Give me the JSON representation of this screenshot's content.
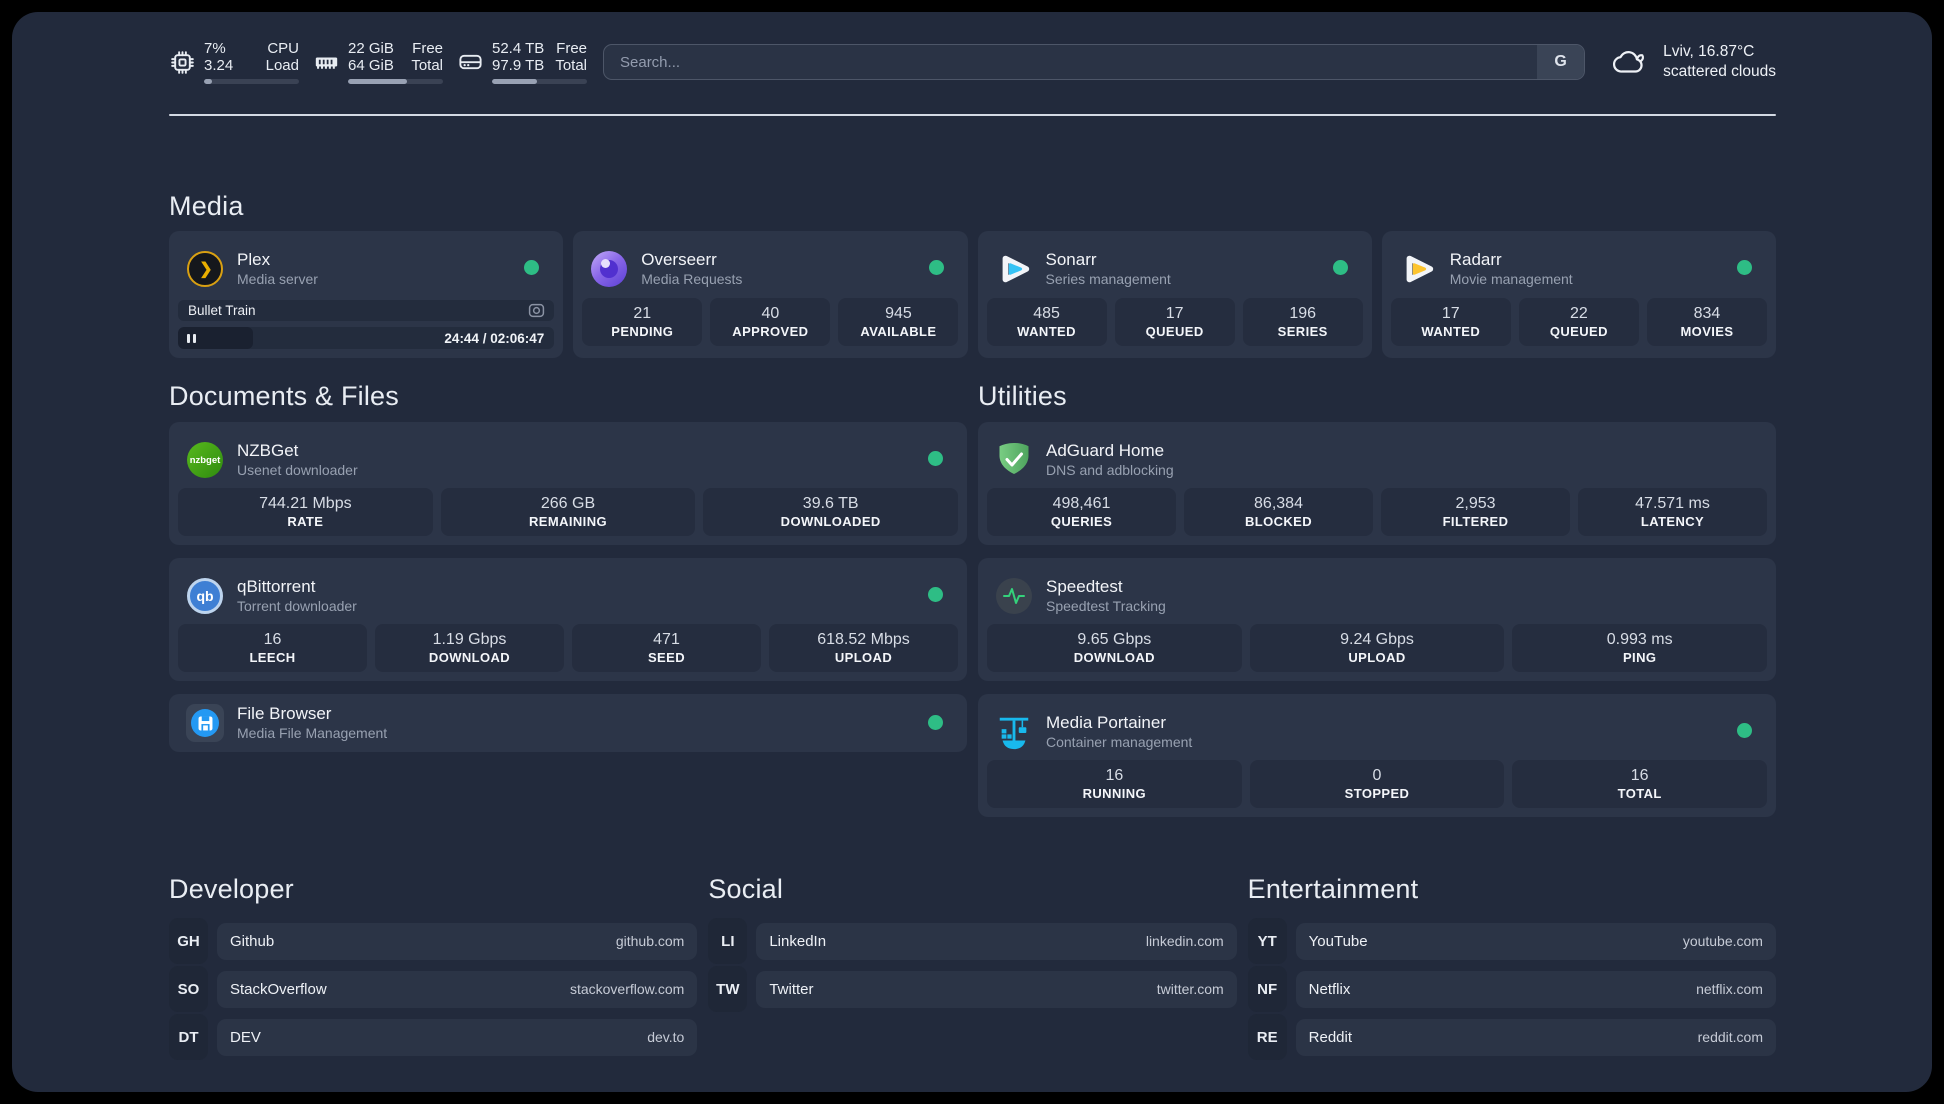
{
  "topbar": {
    "system": [
      {
        "icon": "cpu-icon",
        "col1": [
          "7%",
          "3.24"
        ],
        "col2": [
          "CPU",
          "Load"
        ],
        "progress": 8
      },
      {
        "icon": "ram-icon",
        "col1": [
          "22 GiB",
          "64 GiB"
        ],
        "col2": [
          "Free",
          "Total"
        ],
        "progress": 62
      },
      {
        "icon": "disk-icon",
        "col1": [
          "52.4 TB",
          "97.9 TB"
        ],
        "col2": [
          "Free",
          "Total"
        ],
        "progress": 47
      }
    ],
    "search": {
      "placeholder": "Search...",
      "button": "G"
    },
    "weather": {
      "icon": "cloud-icon",
      "line1": "Lviv, 16.87°C",
      "line2": "scattered clouds"
    }
  },
  "media": {
    "title": "Media",
    "cards": [
      {
        "id": "plex",
        "icon": "plex-icon",
        "title": "Plex",
        "subtitle": "Media server",
        "online": true,
        "player": {
          "track": "Bullet Train",
          "time": "24:44 / 02:06:47",
          "progress": 20
        }
      },
      {
        "id": "overseerr",
        "icon": "overseerr-icon",
        "title": "Overseerr",
        "subtitle": "Media Requests",
        "online": true,
        "stats": [
          {
            "value": "21",
            "label": "PENDING"
          },
          {
            "value": "40",
            "label": "APPROVED"
          },
          {
            "value": "945",
            "label": "AVAILABLE"
          }
        ]
      },
      {
        "id": "sonarr",
        "icon": "sonarr-icon",
        "title": "Sonarr",
        "subtitle": "Series management",
        "online": true,
        "stats": [
          {
            "value": "485",
            "label": "WANTED"
          },
          {
            "value": "17",
            "label": "QUEUED"
          },
          {
            "value": "196",
            "label": "SERIES"
          }
        ]
      },
      {
        "id": "radarr",
        "icon": "radarr-icon",
        "title": "Radarr",
        "subtitle": "Movie management",
        "online": true,
        "stats": [
          {
            "value": "17",
            "label": "WANTED"
          },
          {
            "value": "22",
            "label": "QUEUED"
          },
          {
            "value": "834",
            "label": "MOVIES"
          }
        ]
      }
    ]
  },
  "documents": {
    "title": "Documents & Files",
    "cards": [
      {
        "id": "nzbget",
        "icon": "nzbget-icon",
        "title": "NZBGet",
        "subtitle": "Usenet downloader",
        "online": true,
        "stats": [
          {
            "value": "744.21 Mbps",
            "label": "RATE"
          },
          {
            "value": "266 GB",
            "label": "REMAINING"
          },
          {
            "value": "39.6 TB",
            "label": "DOWNLOADED"
          }
        ]
      },
      {
        "id": "qbittorrent",
        "icon": "qbittorrent-icon",
        "title": "qBittorrent",
        "subtitle": "Torrent downloader",
        "online": true,
        "stats": [
          {
            "value": "16",
            "label": "LEECH"
          },
          {
            "value": "1.19 Gbps",
            "label": "DOWNLOAD"
          },
          {
            "value": "471",
            "label": "SEED"
          },
          {
            "value": "618.52 Mbps",
            "label": "UPLOAD"
          }
        ]
      },
      {
        "id": "filebrowser",
        "icon": "filebrowser-icon",
        "title": "File Browser",
        "subtitle": "Media File Management",
        "online": true,
        "short": true
      }
    ]
  },
  "utilities": {
    "title": "Utilities",
    "cards": [
      {
        "id": "adguard",
        "icon": "adguard-icon",
        "title": "AdGuard Home",
        "subtitle": "DNS and adblocking",
        "online": false,
        "stats": [
          {
            "value": "498,461",
            "label": "QUERIES"
          },
          {
            "value": "86,384",
            "label": "BLOCKED"
          },
          {
            "value": "2,953",
            "label": "FILTERED"
          },
          {
            "value": "47.571 ms",
            "label": "LATENCY"
          }
        ]
      },
      {
        "id": "speedtest",
        "icon": "speedtest-icon",
        "title": "Speedtest",
        "subtitle": "Speedtest Tracking",
        "online": false,
        "stats": [
          {
            "value": "9.65 Gbps",
            "label": "DOWNLOAD"
          },
          {
            "value": "9.24 Gbps",
            "label": "UPLOAD"
          },
          {
            "value": "0.993 ms",
            "label": "PING"
          }
        ]
      },
      {
        "id": "portainer",
        "icon": "portainer-icon",
        "title": "Media Portainer",
        "subtitle": "Container management",
        "online": true,
        "stats": [
          {
            "value": "16",
            "label": "RUNNING"
          },
          {
            "value": "0",
            "label": "STOPPED"
          },
          {
            "value": "16",
            "label": "TOTAL"
          }
        ]
      }
    ]
  },
  "links": [
    {
      "title": "Developer",
      "items": [
        {
          "abbr": "GH",
          "name": "Github",
          "url": "github.com"
        },
        {
          "abbr": "SO",
          "name": "StackOverflow",
          "url": "stackoverflow.com"
        },
        {
          "abbr": "DT",
          "name": "DEV",
          "url": "dev.to"
        }
      ]
    },
    {
      "title": "Social",
      "items": [
        {
          "abbr": "LI",
          "name": "LinkedIn",
          "url": "linkedin.com"
        },
        {
          "abbr": "TW",
          "name": "Twitter",
          "url": "twitter.com"
        }
      ]
    },
    {
      "title": "Entertainment",
      "items": [
        {
          "abbr": "YT",
          "name": "YouTube",
          "url": "youtube.com"
        },
        {
          "abbr": "NF",
          "name": "Netflix",
          "url": "netflix.com"
        },
        {
          "abbr": "RE",
          "name": "Reddit",
          "url": "reddit.com"
        }
      ]
    }
  ],
  "colors": {
    "status_online": "#2ebd85",
    "panel_bg": "#222a3c",
    "card_bg": "#2c3548",
    "plex_accent": "#ebaf00",
    "overseerr_accent": "#8866e8",
    "sonarr_accent": "#36c3f5",
    "radarr_accent": "#fdc42e",
    "nzbget_accent": "#45a318",
    "qbittorrent_accent": "#3e7fd4",
    "adguard_accent": "#68bc71",
    "speedtest_accent": "#34d27b",
    "portainer_accent": "#18b9ed",
    "filebrowser_accent": "#2499f3"
  }
}
